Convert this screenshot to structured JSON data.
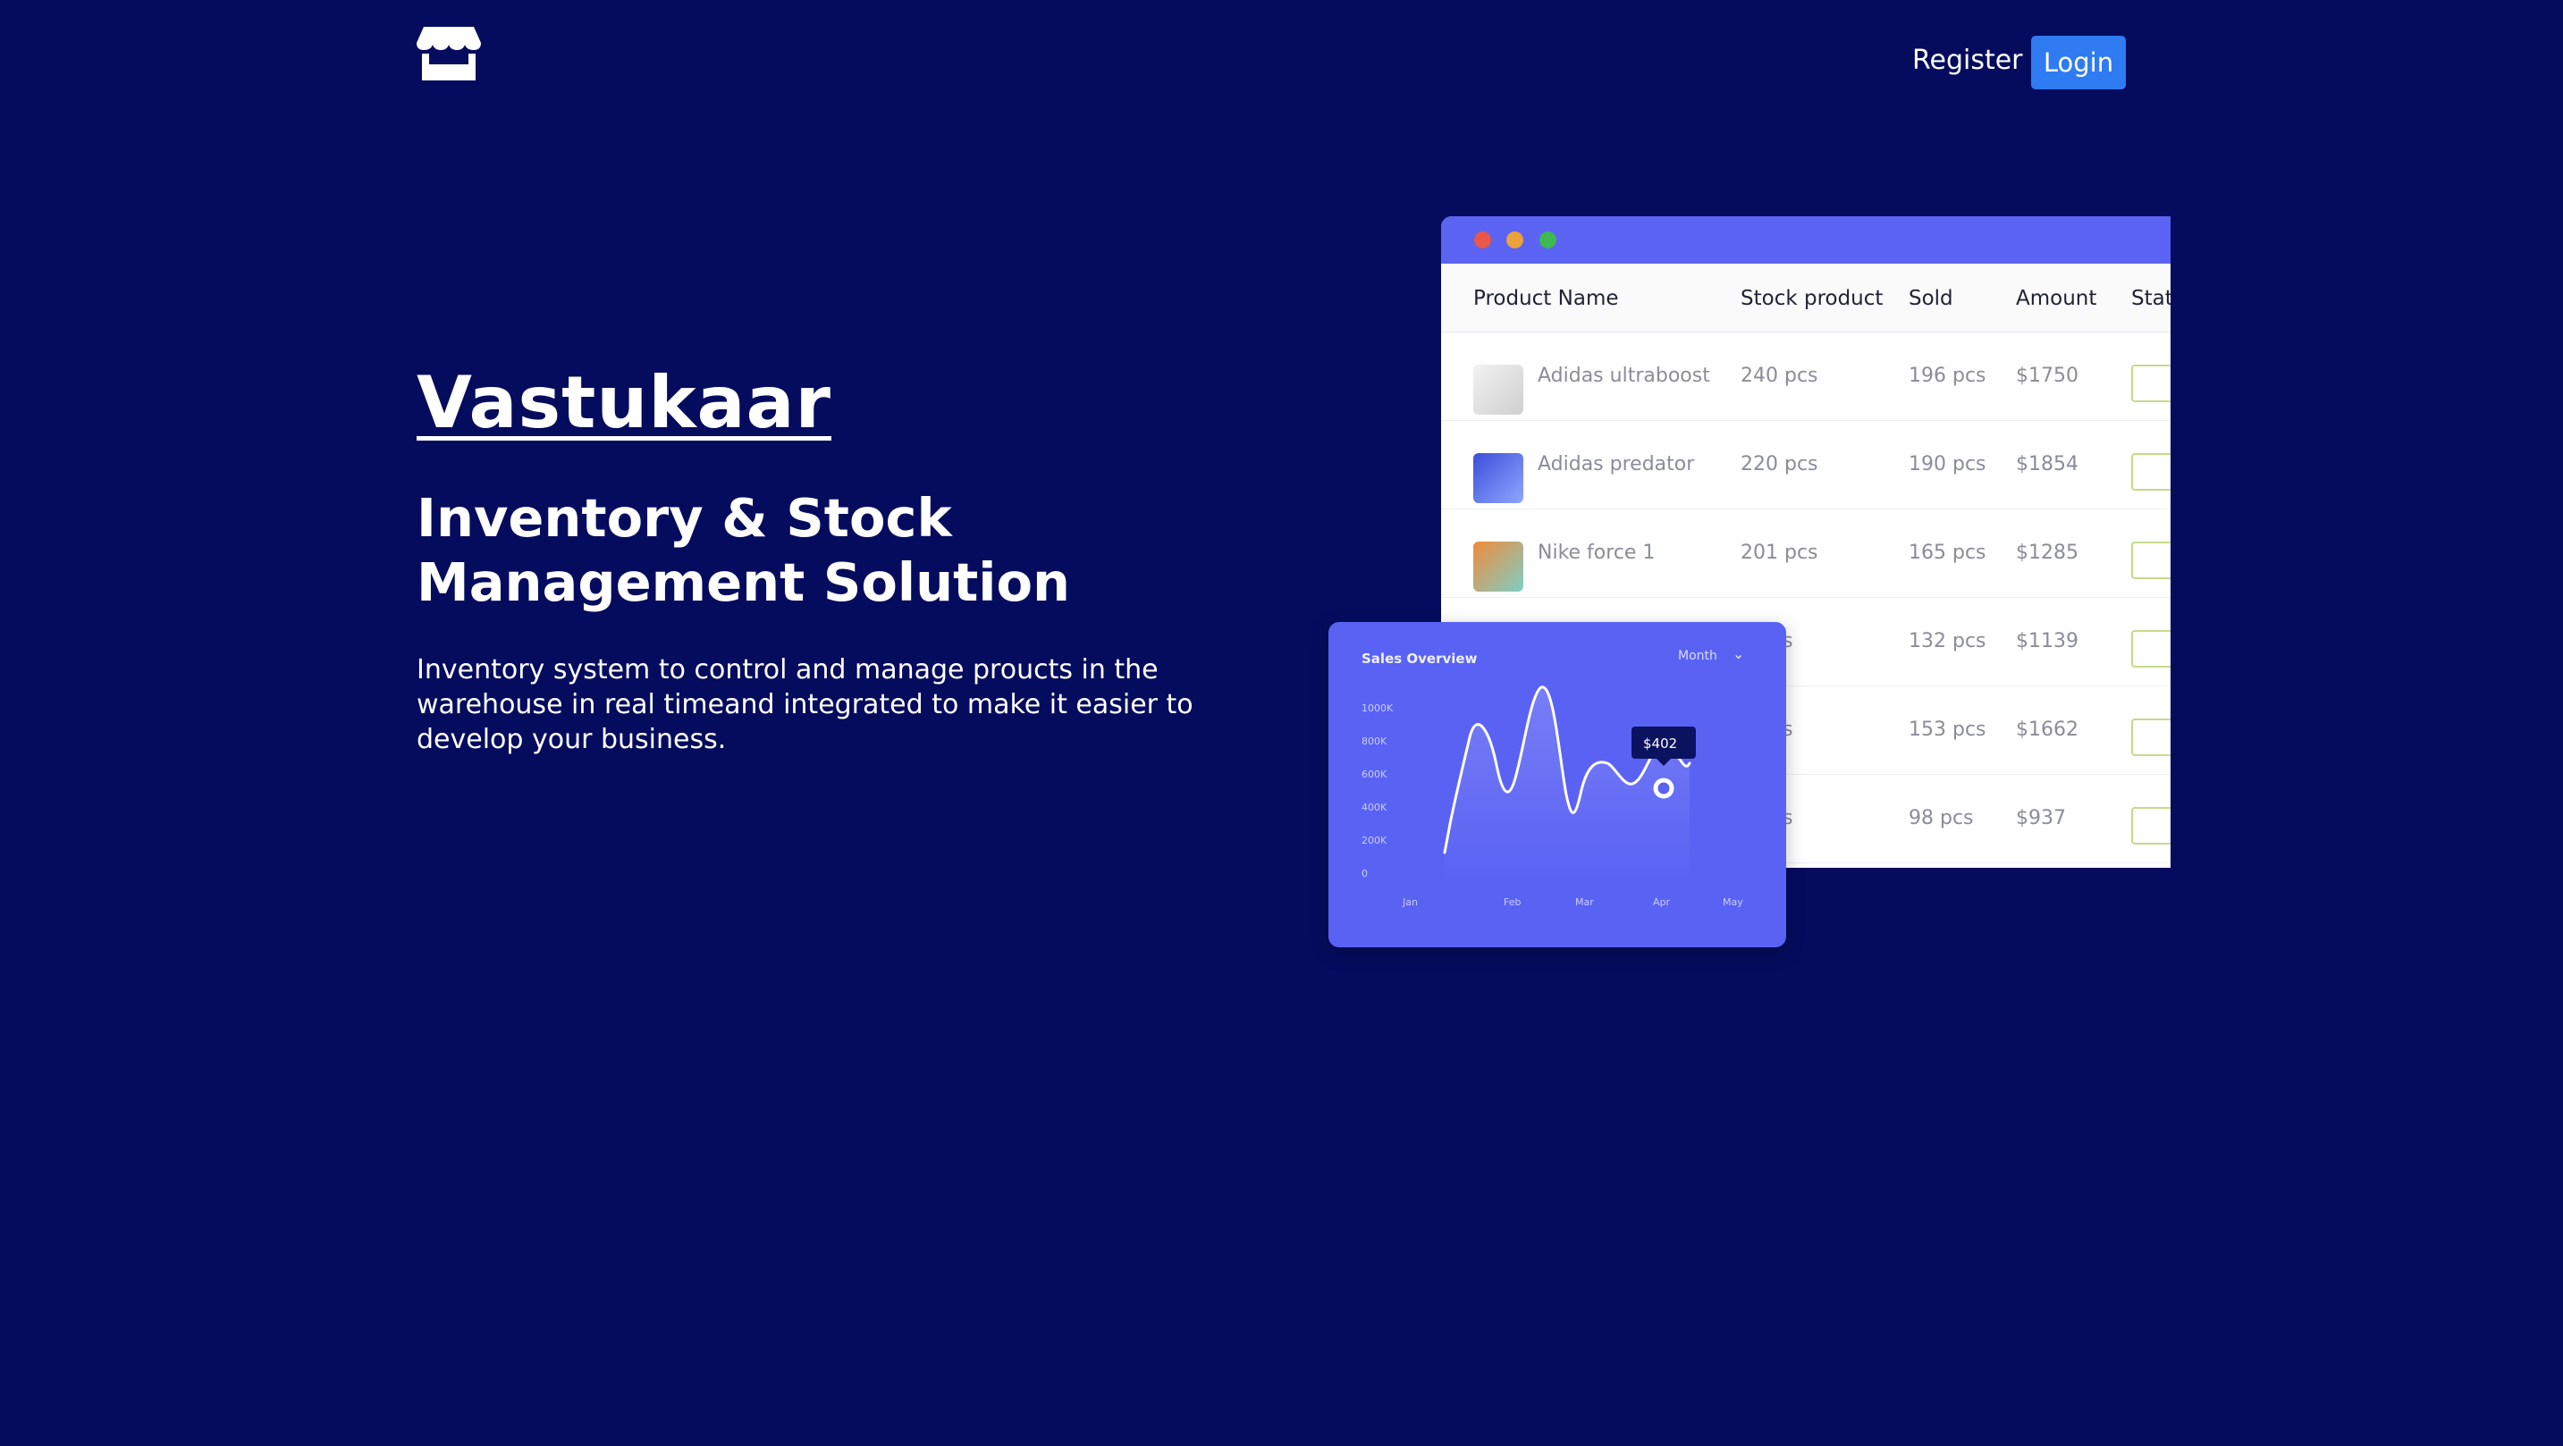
{
  "brand": {
    "logo_icon": "store-icon"
  },
  "nav": {
    "register_label": "Register",
    "login_label": "Login"
  },
  "hero": {
    "title": "Vastukaar",
    "subtitle": "Inventory & Stock Management Solution",
    "description": "Inventory system to control and manage proucts in the warehouse in real timeand integrated to make it easier to develop your business."
  },
  "table_mockup": {
    "columns": [
      "Product Name",
      "Stock product",
      "Sold",
      "Amount",
      "Stat"
    ],
    "rows": [
      {
        "name": "Adidas ultraboost",
        "stock": "240 pcs",
        "sold": "196 pcs",
        "amount": "$1750"
      },
      {
        "name": "Adidas predator",
        "stock": "220 pcs",
        "sold": "190 pcs",
        "amount": "$1854"
      },
      {
        "name": "Nike force 1",
        "stock": "201 pcs",
        "sold": "165 pcs",
        "amount": "$1285"
      },
      {
        "name": "",
        "stock": "cs",
        "sold": "132 pcs",
        "amount": "$1139"
      },
      {
        "name": "",
        "stock": "cs",
        "sold": "153 pcs",
        "amount": "$1662"
      },
      {
        "name": "",
        "stock": "cs",
        "sold": "98 pcs",
        "amount": "$937"
      }
    ]
  },
  "sales_chart": {
    "title": "Sales Overview",
    "period": "Month",
    "y_ticks": [
      "1000K",
      "800K",
      "600K",
      "400K",
      "200K",
      "0"
    ],
    "x_ticks": [
      "Jan",
      "Feb",
      "Mar",
      "Apr",
      "May"
    ],
    "tooltip": "$402"
  },
  "colors": {
    "page_bg": "#050c5e",
    "login_button": "#2f7bf1",
    "mockup_accent": "#5b63f2"
  }
}
